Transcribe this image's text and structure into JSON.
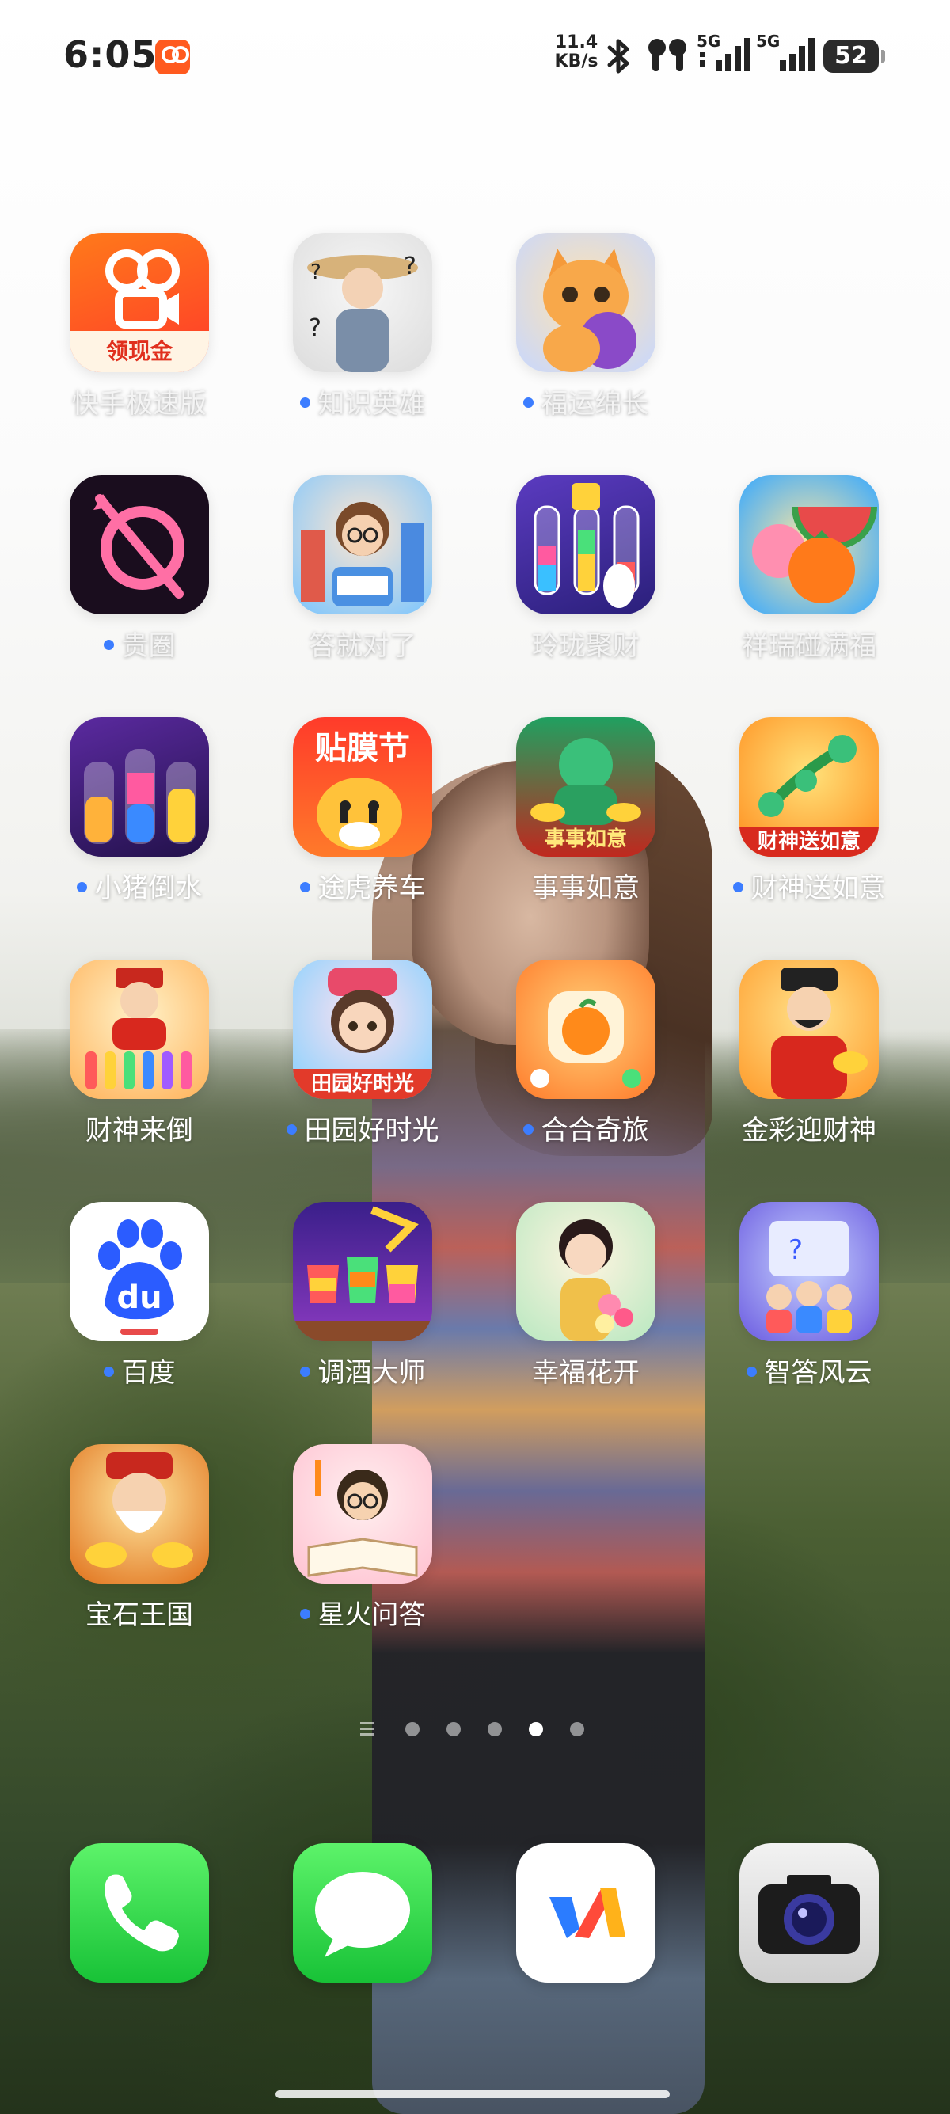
{
  "status_bar": {
    "time": "6:05",
    "net_speed_value": "11.4",
    "net_speed_unit": "KB/s",
    "signal1_label": "5G",
    "signal2_label": "5G",
    "battery": "52"
  },
  "apps": [
    {
      "label": "快手极速版",
      "icon": "kuaishou-icon",
      "icon_text": "领现金",
      "new": false
    },
    {
      "label": "知识英雄",
      "icon": "scholar-icon",
      "new": true
    },
    {
      "label": "福运绵长",
      "icon": "cat-icon",
      "new": true
    },
    {
      "label": "贵圈",
      "icon": "planet-icon",
      "new": true
    },
    {
      "label": "答就对了",
      "icon": "reading-girl-icon",
      "new": false
    },
    {
      "label": "玲珑聚财",
      "icon": "tubes-icon",
      "new": false
    },
    {
      "label": "祥瑞碰满福",
      "icon": "fruit-icon",
      "new": false
    },
    {
      "label": "小猪倒水",
      "icon": "bottles-icon",
      "new": true
    },
    {
      "label": "途虎养车",
      "icon": "tiger-icon",
      "icon_text": "贴膜节",
      "new": true
    },
    {
      "label": "事事如意",
      "icon": "jade-god-icon",
      "icon_text": "事事如意",
      "new": false
    },
    {
      "label": "财神送如意",
      "icon": "ruyi-icon",
      "icon_text": "财神送如意",
      "new": true
    },
    {
      "label": "财神来倒",
      "icon": "fortune-god-icon",
      "new": false
    },
    {
      "label": "田园好时光",
      "icon": "farm-girl-icon",
      "icon_text": "田园好时光",
      "new": true
    },
    {
      "label": "合合奇旅",
      "icon": "orange-icon",
      "new": true
    },
    {
      "label": "金彩迎财神",
      "icon": "wealth-god-icon",
      "new": false
    },
    {
      "label": "百度",
      "icon": "baidu-paw-icon",
      "icon_text": "du",
      "new": true
    },
    {
      "label": "调酒大师",
      "icon": "cocktail-icon",
      "new": true
    },
    {
      "label": "幸福花开",
      "icon": "flower-lady-icon",
      "new": false
    },
    {
      "label": "智答风云",
      "icon": "quiz-kids-icon",
      "new": true
    },
    {
      "label": "宝石王国",
      "icon": "gem-god-icon",
      "new": false
    },
    {
      "label": "星火问答",
      "icon": "book-boy-icon",
      "new": true
    }
  ],
  "page_indicator": {
    "total": 5,
    "active": 4
  },
  "dock": [
    {
      "name": "phone",
      "icon": "phone-icon"
    },
    {
      "name": "messages",
      "icon": "message-bubble-icon"
    },
    {
      "name": "vivo",
      "icon": "vivo-logo-icon"
    },
    {
      "name": "camera",
      "icon": "camera-icon"
    }
  ]
}
